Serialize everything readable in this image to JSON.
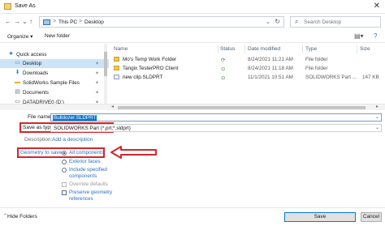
{
  "window": {
    "title": "Save As",
    "close_glyph": "✕",
    "icon": "save-as-app-icon"
  },
  "address": {
    "crumbs": [
      "This PC",
      "Desktop"
    ],
    "separator": ">",
    "pc_icon": "computer-icon",
    "search_placeholder": "Search Desktop"
  },
  "nav_buttons": {
    "back": "←",
    "forward": "→",
    "recent": "⌄",
    "up": "↑"
  },
  "toolbar": {
    "organize": "Organize ▾",
    "new_folder": "New folder",
    "view_icon": "▤▾",
    "help_icon": "?"
  },
  "nav_pane": {
    "items": [
      {
        "label": "Quick access",
        "icon": "star-icon",
        "glyph": "★",
        "color": "#2e7fd6",
        "pinned": false,
        "selected": false
      },
      {
        "label": "Desktop",
        "icon": "desktop-folder-icon",
        "glyph": "▭",
        "color": "#2e7fd6",
        "pinned": true,
        "selected": true
      },
      {
        "label": "Downloads",
        "icon": "download-icon",
        "glyph": "⬇",
        "color": "#2e7fd6",
        "pinned": true,
        "selected": false
      },
      {
        "label": "SolidWorks Sample Files",
        "icon": "folder-icon",
        "glyph": "▬",
        "color": "#e3b12d",
        "pinned": true,
        "selected": false
      },
      {
        "label": "Documents",
        "icon": "documents-icon",
        "glyph": "▤",
        "color": "#6b7b92",
        "pinned": true,
        "selected": false
      },
      {
        "label": "DATADRIVE0 (D:)",
        "icon": "drive-icon",
        "glyph": "▭",
        "color": "#5a5a5a",
        "pinned": true,
        "selected": false
      }
    ],
    "pin_glyph": "✦"
  },
  "file_list": {
    "columns": [
      "Name",
      "Status",
      "Date modified",
      "Type",
      "Size"
    ],
    "rows": [
      {
        "name": "Mo's Temp Work Folder",
        "type_icon": "folder-icon",
        "status": "⟳",
        "status_color": "#3a8a3a",
        "date": "8/24/2021 11:21 AM",
        "type": "File folder",
        "size": ""
      },
      {
        "name": "Tangix TesterPRO Client",
        "type_icon": "folder-icon",
        "status": "⊙",
        "status_color": "#3a8a3a",
        "date": "8/24/2021 11:18 AM",
        "type": "File folder",
        "size": ""
      },
      {
        "name": "new clip.SLDPRT",
        "type_icon": "sldprt-file-icon",
        "status": "⊙",
        "status_color": "#3a8a3a",
        "date": "11/1/2021 10:51 AM",
        "type": "SOLIDWORKS Part ...",
        "size": "147 KB"
      }
    ]
  },
  "save_form": {
    "file_name_label": "File name:",
    "file_name_value": "Bulldozer.SLDPRT",
    "save_type_label": "Save as type:",
    "save_type_value": "SOLIDWORKS Part (*.prt;*.sldprt)",
    "description_label": "Description:",
    "description_link": "Add a description",
    "geometry_label": "Geometry to save:",
    "options": [
      {
        "label": "All components",
        "kind": "radio",
        "checked": true,
        "disabled": false
      },
      {
        "label": "Exterior faces",
        "kind": "radio",
        "checked": false,
        "disabled": false
      },
      {
        "label": "Include specified\ncomponents",
        "kind": "radio",
        "checked": false,
        "disabled": false
      },
      {
        "label": "Override defaults",
        "kind": "checkbox",
        "checked": false,
        "disabled": true
      },
      {
        "label": "Preserve geometry\nreferences",
        "kind": "checkbox",
        "checked": false,
        "disabled": false
      }
    ],
    "dropdown_glyph": "⌄",
    "annotation_color": "#d2272d"
  },
  "footer": {
    "hide_folders": "Hide Folders",
    "caret": "⌃",
    "save_button": "Save",
    "cancel_button": "Cancel"
  }
}
